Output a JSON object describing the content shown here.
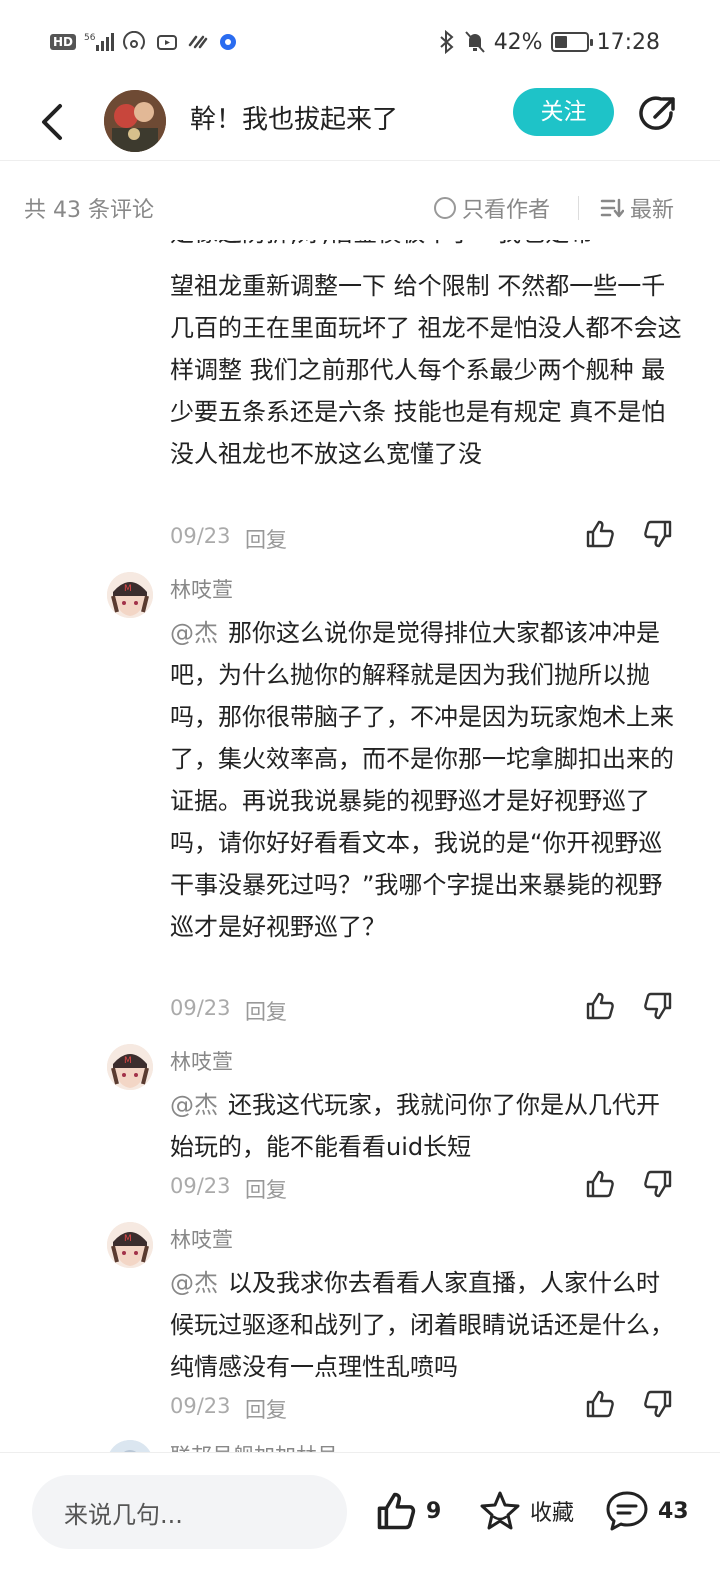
{
  "status": {
    "time": "17:28",
    "battery": "42%",
    "battery_level": 0.42,
    "network": "56",
    "hd": "HD"
  },
  "header": {
    "title": "幹！我也拔起来了",
    "follow": "关注"
  },
  "subheader": {
    "count": "共 43 条评论",
    "author_only": "只看作者",
    "sort": "最新"
  },
  "comments": [
    {
      "text_partial_top": "是像这防拆,好,借鉴模板不了一我也是希",
      "text": "望祖龙重新调整一下  给个限制  不然都一些一千几百的王在里面玩坏了  祖龙不是怕没人都不会这样调整  我们之前那代人每个系最少两个舰种  最少要五条系还是六条  技能也是有规定  真不是怕没人祖龙也不放这么宽懂了没",
      "date": "09/23",
      "reply": "回复"
    },
    {
      "username": "林吱萱",
      "at": "@杰",
      "text": "那你这么说你是觉得排位大家都该冲冲是吧，为什么抛你的解释就是因为我们抛所以抛吗，那你很带脑子了，不冲是因为玩家炮术上来了，集火效率高，而不是你那一坨拿脚扣出来的证据。再说我说暴毙的视野巡才是好视野巡了吗，请你好好看看文本，我说的是“你开视野巡干事没暴死过吗？”我哪个字提出来暴毙的视野巡才是好视野巡了？",
      "date": "09/23",
      "reply": "回复"
    },
    {
      "username": "林吱萱",
      "at": "@杰",
      "text": "还我这代玩家，我就问你了你是从几代开始玩的，能不能看看uid长短",
      "date": "09/23",
      "reply": "回复"
    },
    {
      "username": "林吱萱",
      "at": "@杰",
      "text": "以及我求你去看看人家直播，人家什么时候玩过驱逐和战列了，闭着眼睛说话还是什么，纯情感没有一点理性乱喷吗",
      "date": "09/23",
      "reply": "回复"
    },
    {
      "username_partial": "联邦号舰加加林号"
    }
  ],
  "bottom": {
    "placeholder": "来说几句...",
    "likes": "9",
    "favorite": "收藏",
    "comments": "43"
  },
  "colors": {
    "accent": "#1ec3c8",
    "muted": "#888888",
    "text": "#222222"
  }
}
